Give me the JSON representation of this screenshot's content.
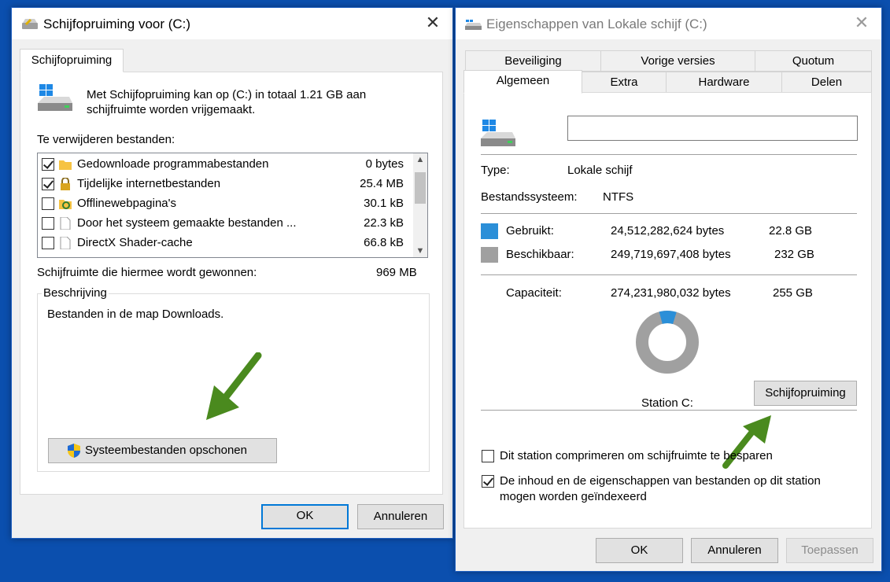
{
  "cleanup": {
    "title": "Schijfopruiming voor  (C:)",
    "tab": "Schijfopruiming",
    "intro_line1": "Met Schijfopruiming kan op  (C:) in totaal 1.21 GB aan",
    "intro_line2": "schijfruimte worden vrijgemaakt.",
    "files_label": "Te verwijderen bestanden:",
    "files": [
      {
        "name": "Gedownloade programmabestanden",
        "size": "0 bytes",
        "checked": true,
        "icon": "folder-icon"
      },
      {
        "name": "Tijdelijke internetbestanden",
        "size": "25.4 MB",
        "checked": true,
        "icon": "lock-icon"
      },
      {
        "name": "Offlinewebpagina's",
        "size": "30.1 kB",
        "checked": false,
        "icon": "sync-folder-icon"
      },
      {
        "name": "Door het systeem gemaakte bestanden ...",
        "size": "22.3 kB",
        "checked": false,
        "icon": "file-icon"
      },
      {
        "name": "DirectX Shader-cache",
        "size": "66.8 kB",
        "checked": false,
        "icon": "file-icon"
      }
    ],
    "gain_label": "Schijfruimte die hiermee wordt gewonnen:",
    "gain_value": "969 MB",
    "description_label": "Beschrijving",
    "description_text": "Bestanden in de map Downloads.",
    "system_button": "Systeembestanden opschonen",
    "ok": "OK",
    "cancel": "Annuleren"
  },
  "props": {
    "title": "Eigenschappen van Lokale schijf (C:)",
    "tabs_top": [
      "Beveiliging",
      "Vorige versies",
      "Quotum"
    ],
    "tabs_bottom": [
      "Algemeen",
      "Extra",
      "Hardware",
      "Delen"
    ],
    "name_value": "",
    "type_label": "Type:",
    "type_value": "Lokale schijf",
    "fs_label": "Bestandssysteem:",
    "fs_value": "NTFS",
    "used_label": "Gebruikt:",
    "used_bytes": "24,512,282,624 bytes",
    "used_gb": "22.8 GB",
    "free_label": "Beschikbaar:",
    "free_bytes": "249,719,697,408 bytes",
    "free_gb": "232 GB",
    "cap_label": "Capaciteit:",
    "cap_bytes": "274,231,980,032 bytes",
    "cap_gb": "255 GB",
    "used_fraction": 0.089,
    "station_label": "Station C:",
    "cleanup_button": "Schijfopruiming",
    "compress_label": "Dit station comprimeren om schijfruimte te besparen",
    "index_label_line1": "De inhoud en de eigenschappen van bestanden op dit station",
    "index_label_line2": "mogen worden geïndexeerd",
    "compress_checked": false,
    "index_checked": true,
    "ok": "OK",
    "cancel": "Annuleren",
    "apply": "Toepassen"
  },
  "colors": {
    "used": "#2b8fd8",
    "free": "#a0a0a0",
    "arrow": "#4a8a1e"
  }
}
